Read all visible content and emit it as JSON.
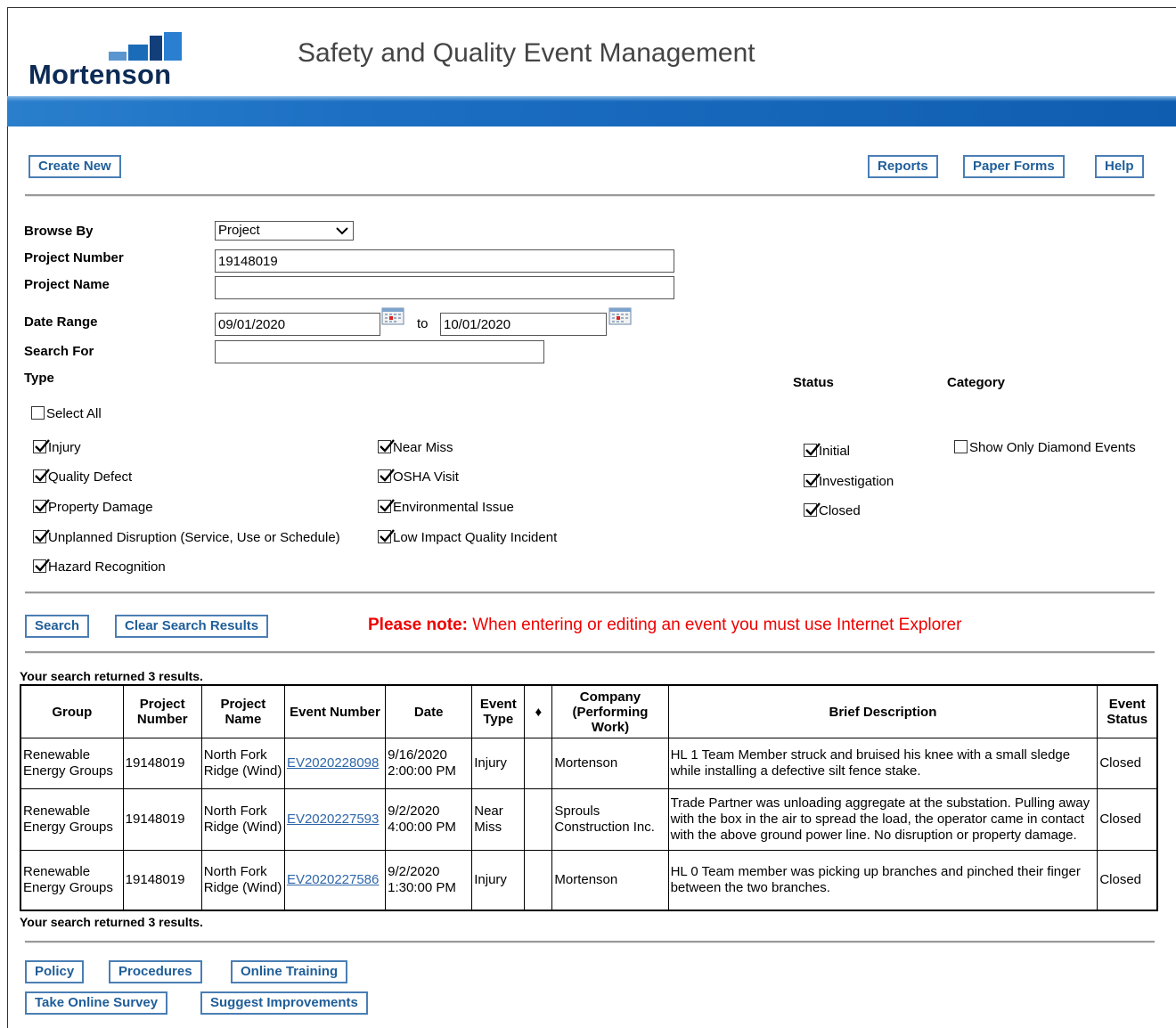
{
  "header": {
    "logo_text": "Mortenson",
    "app_title": "Safety and Quality Event Management"
  },
  "toolbar": {
    "create_new": "Create New",
    "reports": "Reports",
    "paper_forms": "Paper Forms",
    "help": "Help"
  },
  "form": {
    "browse_by_label": "Browse By",
    "browse_by_value": "Project",
    "project_number_label": "Project Number",
    "project_number_value": "19148019",
    "project_name_label": "Project Name",
    "project_name_value": "",
    "date_range_label": "Date Range",
    "date_from": "09/01/2020",
    "date_to_word": "to",
    "date_to": "10/01/2020",
    "search_for_label": "Search For",
    "search_for_value": "",
    "type_label": "Type",
    "status_label": "Status",
    "category_label": "Category",
    "select_all": "Select All",
    "types": [
      "Injury",
      "Quality Defect",
      "Property Damage",
      "Unplanned Disruption (Service, Use or Schedule)",
      "Hazard Recognition",
      "Near Miss",
      "OSHA Visit",
      "Environmental Issue",
      "Low Impact Quality Incident"
    ],
    "statuses": [
      "Initial",
      "Investigation",
      "Closed"
    ],
    "category_option": "Show Only Diamond Events"
  },
  "actions": {
    "search": "Search",
    "clear": "Clear Search Results",
    "note_bold": "Please note:",
    "note_text": " When entering or editing an event you must use Internet Explorer"
  },
  "results": {
    "summary": "Your search returned 3 results.",
    "headers": [
      "Group",
      "Project Number",
      "Project Name",
      "Event Number",
      "Date",
      "Event Type",
      "♦",
      "Company (Performing Work)",
      "Brief Description",
      "Event Status"
    ],
    "rows": [
      {
        "group": "Renewable Energy Groups",
        "project_number": "19148019",
        "project_name": "North Fork Ridge (Wind)",
        "event_number": "EV2020228098",
        "date": "9/16/2020",
        "time": "2:00:00 PM",
        "event_type": "Injury",
        "diamond": "",
        "company": "Mortenson",
        "description": "HL 1 Team Member struck and bruised his knee with a small sledge while installing a defective silt fence stake.",
        "status": "Closed"
      },
      {
        "group": "Renewable Energy Groups",
        "project_number": "19148019",
        "project_name": "North Fork Ridge (Wind)",
        "event_number": "EV2020227593",
        "date": "9/2/2020",
        "time": "4:00:00 PM",
        "event_type": "Near Miss",
        "diamond": "",
        "company": "Sprouls Construction Inc.",
        "description": "Trade Partner was unloading aggregate at the substation. Pulling away with the box in the air to spread the load, the operator came in contact with the above ground power line. No disruption or property damage.",
        "status": "Closed"
      },
      {
        "group": "Renewable Energy Groups",
        "project_number": "19148019",
        "project_name": "North Fork Ridge (Wind)",
        "event_number": "EV2020227586",
        "date": "9/2/2020",
        "time": "1:30:00 PM",
        "event_type": "Injury",
        "diamond": "",
        "company": "Mortenson",
        "description": "HL 0 Team member was picking up branches and pinched their finger between the two branches.",
        "status": "Closed"
      }
    ]
  },
  "footer": {
    "policy": "Policy",
    "procedures": "Procedures",
    "online_training": "Online Training",
    "take_survey": "Take Online Survey",
    "suggest": "Suggest Improvements"
  },
  "colors": {
    "brand_blue": "#1b6cb8",
    "button_border": "#4a7eb4",
    "button_text": "#1f5e99",
    "note_red": "#e00000",
    "link": "#2f66a8"
  }
}
